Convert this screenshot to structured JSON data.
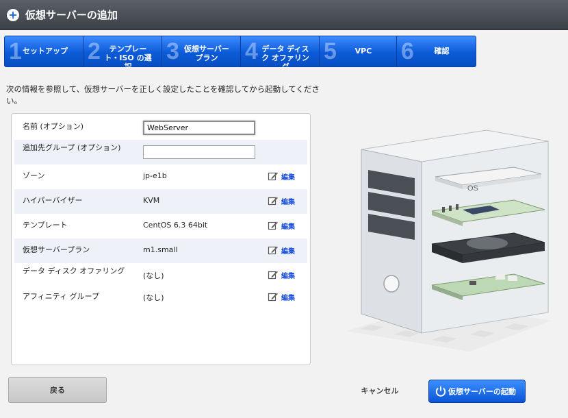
{
  "window": {
    "title": "仮想サーバーの追加"
  },
  "steps": [
    {
      "num": "1",
      "label": "セットアップ"
    },
    {
      "num": "2",
      "label": "テンプレー\nト・ISO の選\n択"
    },
    {
      "num": "3",
      "label": "仮想サーバー\nプラン"
    },
    {
      "num": "4",
      "label": "データ ディス\nク オファリン\nグ"
    },
    {
      "num": "5",
      "label": "VPC"
    },
    {
      "num": "6",
      "label": "確認"
    }
  ],
  "instruction": "次の情報を参照して、仮想サーバーを正しく設定したことを確認してから起動してください。",
  "form": {
    "rows": [
      {
        "label": "名前 (オプション)",
        "input_value": "WebServer"
      },
      {
        "label": "追加先グループ (オプション)",
        "input_value": ""
      },
      {
        "label": "ゾーン",
        "value": "jp-e1b",
        "edit": "編集"
      },
      {
        "label": "ハイパーバイザー",
        "value": "KVM",
        "edit": "編集"
      },
      {
        "label": "テンプレート",
        "value": "CentOS 6.3 64bit",
        "edit": "編集"
      },
      {
        "label": "仮想サーバープラン",
        "value": "m1.small",
        "edit": "編集"
      },
      {
        "label": "データ ディスク オファリング",
        "value": "(なし)",
        "edit": "編集"
      },
      {
        "label": "アフィニティ グループ",
        "value": "(なし)",
        "edit": "編集"
      }
    ]
  },
  "illustration": {
    "os_label": "OS"
  },
  "buttons": {
    "back": "戻る",
    "cancel": "キャンセル",
    "launch": "仮想サーバーの起動"
  },
  "colors": {
    "accent": "#0b5ad8",
    "titlebar": "#4a5058",
    "link": "#1a4fd8"
  }
}
